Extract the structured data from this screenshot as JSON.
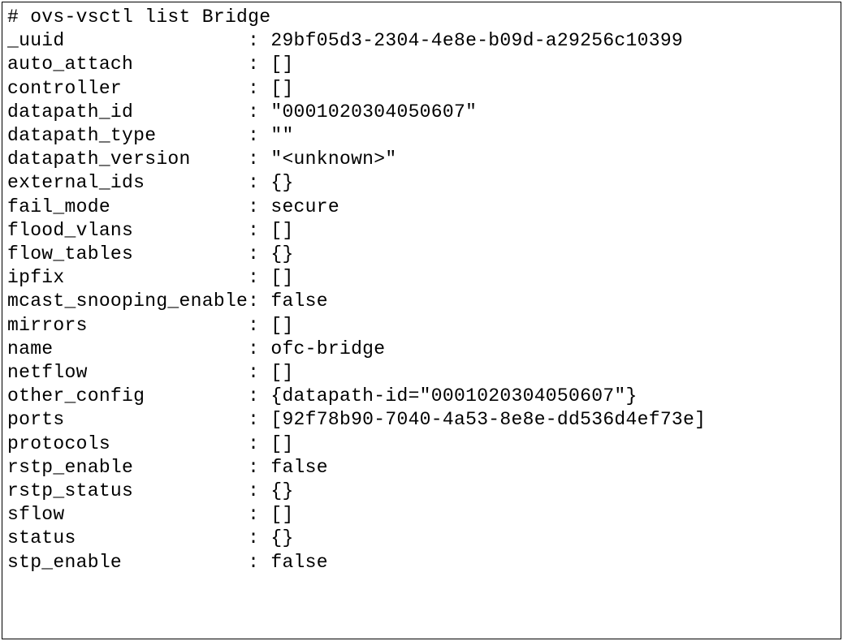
{
  "command": "# ovs-vsctl list Bridge",
  "rows": [
    {
      "key": "_uuid",
      "value": "29bf05d3-2304-4e8e-b09d-a29256c10399"
    },
    {
      "key": "auto_attach",
      "value": "[]"
    },
    {
      "key": "controller",
      "value": "[]"
    },
    {
      "key": "datapath_id",
      "value": "\"0001020304050607\""
    },
    {
      "key": "datapath_type",
      "value": "\"\""
    },
    {
      "key": "datapath_version",
      "value": "\"<unknown>\""
    },
    {
      "key": "external_ids",
      "value": "{}"
    },
    {
      "key": "fail_mode",
      "value": "secure"
    },
    {
      "key": "flood_vlans",
      "value": "[]"
    },
    {
      "key": "flow_tables",
      "value": "{}"
    },
    {
      "key": "ipfix",
      "value": "[]"
    },
    {
      "key": "mcast_snooping_enable",
      "value": "false"
    },
    {
      "key": "mirrors",
      "value": "[]"
    },
    {
      "key": "name",
      "value": "ofc-bridge"
    },
    {
      "key": "netflow",
      "value": "[]"
    },
    {
      "key": "other_config",
      "value": "{datapath-id=\"0001020304050607\"}"
    },
    {
      "key": "ports",
      "value": "[92f78b90-7040-4a53-8e8e-dd536d4ef73e]"
    },
    {
      "key": "protocols",
      "value": "[]"
    },
    {
      "key": "rstp_enable",
      "value": "false"
    },
    {
      "key": "rstp_status",
      "value": "{}"
    },
    {
      "key": "sflow",
      "value": "[]"
    },
    {
      "key": "status",
      "value": "{}"
    },
    {
      "key": "stp_enable",
      "value": "false"
    }
  ],
  "key_col_width": 21
}
